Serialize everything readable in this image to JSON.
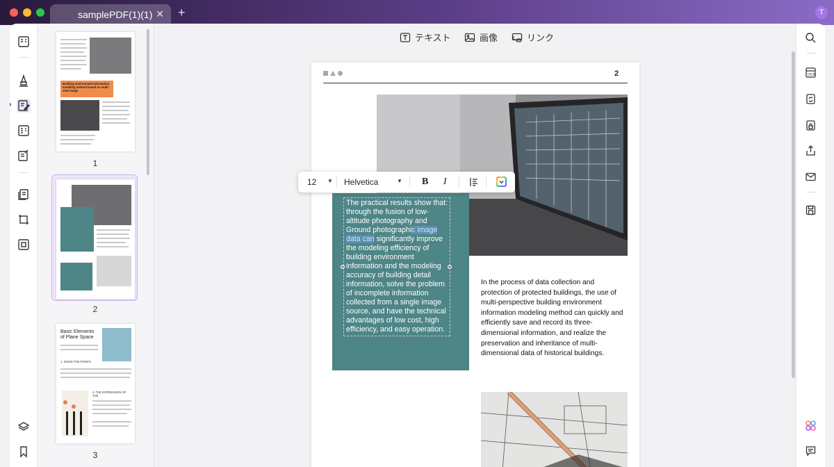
{
  "app": {
    "tab_title": "samplePDF(1)(1)",
    "tab_close": "✕",
    "tab_add": "+",
    "avatar_letter": "T",
    "accent": "#7a58c8"
  },
  "toolbar": {
    "text_label": "テキスト",
    "image_label": "画像",
    "link_label": "リンク"
  },
  "thumbnails": [
    {
      "number": "1",
      "heading": "Building environment information modeling method based on multi-view image"
    },
    {
      "number": "2"
    },
    {
      "number": "3",
      "heading": "Basic Elements of Plane Space",
      "sub1": "1. KNOW THE POINTS",
      "sub2": "2. THE EXPRESSION OF THE"
    }
  ],
  "page": {
    "number": "2",
    "edit_text_before": "The practical results show that: through the fusion of low-altitude photography and Ground photographi",
    "edit_text_selected": "c image data can",
    "edit_text_after": " significantly improve the modeling efficiency of building environment information and the modeling accuracy of building detail information, solve the problem of incomplete information collected from a single image source, and have the technical advantages of low cost, high efficiency, and easy operation.",
    "right_text": "In the process of data collection and protection of protected buildings, the use of multi-perspective building environment information modeling method can quickly and efficiently save and record its three-dimensional information, and realize the preservation and inheritance of multi-dimensional data of historical buildings."
  },
  "format_toolbar": {
    "font_size": "12",
    "font_family": "Helvetica",
    "bold": "B",
    "italic": "I"
  }
}
